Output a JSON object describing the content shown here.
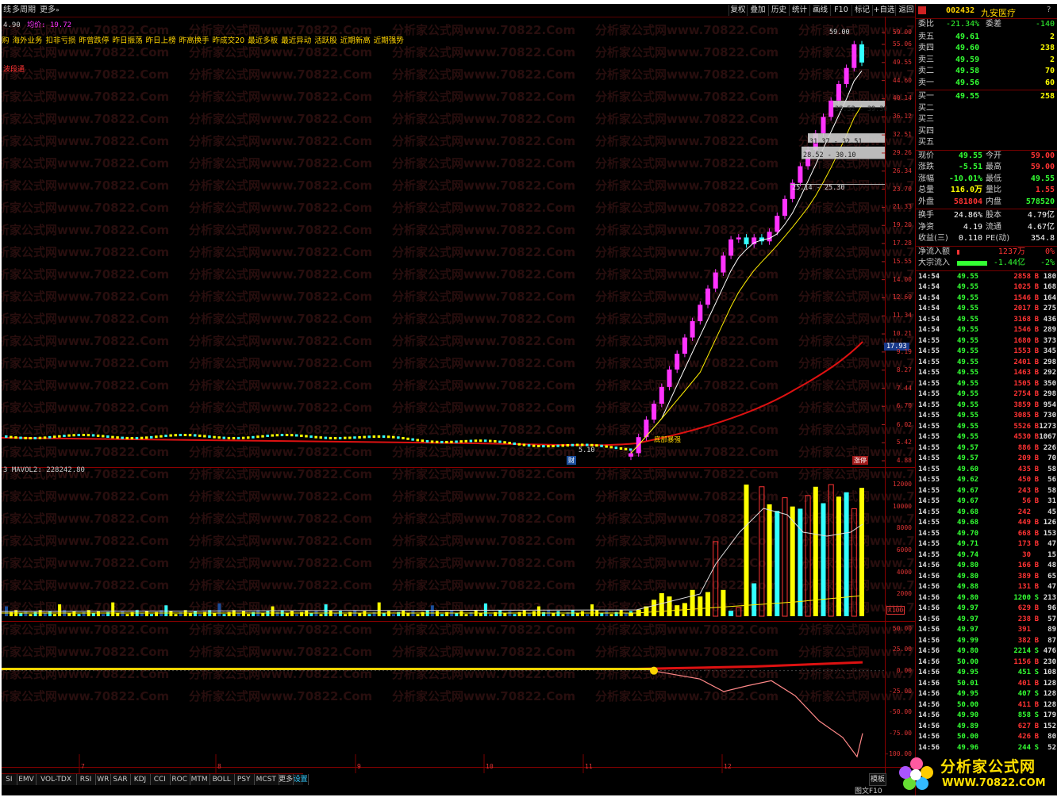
{
  "toolbar": {
    "left_items": [
      "线",
      "多周期",
      "更多"
    ],
    "right_buttons": [
      "复权",
      "叠加",
      "历史",
      "统计",
      "F10",
      "标记",
      "+自选",
      "返回"
    ],
    "overlay_btn": "画线"
  },
  "chart_header": {
    "value1": "4.90",
    "label2": "均价",
    "value2": "19.72"
  },
  "indicators": [
    "购",
    "海外业务",
    "扣非亏损",
    "昨曾跌停",
    "昨日振荡",
    "昨日上榜",
    "昨高换手",
    "昨成交20",
    "最近多板",
    "最近异动",
    "活跃股",
    "近期新高",
    "近期强势"
  ],
  "side_label": "波段通",
  "price_axis": [
    "59.00",
    "55.06",
    "49.55",
    "44.60",
    "40.14",
    "36.12",
    "32.51",
    "29.26",
    "26.34",
    "23.70",
    "21.33",
    "19.20",
    "17.28",
    "15.55",
    "14.00",
    "12.60",
    "11.34",
    "10.21",
    "9.19",
    "8.27",
    "7.44",
    "6.70",
    "6.02",
    "5.42",
    "4.88"
  ],
  "price_marks": {
    "top": "59.00",
    "current": "17.93",
    "low": "5.10",
    "annot": "底部暴强"
  },
  "gaps": [
    "38.52 - 39.30",
    "31.37 - 32.51",
    "28.52 - 30.10",
    "25.14 - 25.30"
  ],
  "badges": {
    "fin": "财",
    "limit": "涨停"
  },
  "volume_pane": {
    "label": "MAVOL2: 228242.80",
    "axis": [
      "12000",
      "10000",
      "8000",
      "6000",
      "4000",
      "2000"
    ],
    "unit": "X100"
  },
  "osc_axis": [
    "50.00",
    "25.00",
    "0.00",
    "-25.00",
    "-50.00",
    "-75.00",
    "-100.00"
  ],
  "month_marks": [
    "7",
    "8",
    "9",
    "10",
    "11",
    "12"
  ],
  "bottom_tabs": [
    "SI",
    "EMV",
    "VOL-TDX",
    "RSI",
    "WR",
    "SAR",
    "KDJ",
    "CCI",
    "ROC",
    "MTM",
    "BOLL",
    "PSY",
    "MCST",
    "更多",
    "设置"
  ],
  "bottom_right": [
    "模板",
    "图文F10"
  ],
  "stock": {
    "code": "002432",
    "name": "九安医疗"
  },
  "quote_top": [
    {
      "label": "委比",
      "v1": "-21.34%",
      "label2": "委差",
      "v2": "-140"
    }
  ],
  "order_book": {
    "asks": [
      {
        "label": "卖五",
        "price": "49.61",
        "vol": "2"
      },
      {
        "label": "卖四",
        "price": "49.60",
        "vol": "238"
      },
      {
        "label": "卖三",
        "price": "49.59",
        "vol": "2"
      },
      {
        "label": "卖二",
        "price": "49.58",
        "vol": "70"
      },
      {
        "label": "卖一",
        "price": "49.56",
        "vol": "60"
      }
    ],
    "bids": [
      {
        "label": "买一",
        "price": "49.55",
        "vol": "258"
      },
      {
        "label": "买二",
        "price": "",
        "vol": ""
      },
      {
        "label": "买三",
        "price": "",
        "vol": ""
      },
      {
        "label": "买四",
        "price": "",
        "vol": ""
      },
      {
        "label": "买五",
        "price": "",
        "vol": ""
      }
    ]
  },
  "quote_stats": [
    {
      "l1": "现价",
      "v1": "49.55",
      "c1": "#33ff33",
      "l2": "今开",
      "v2": "59.00",
      "c2": "#ff3333"
    },
    {
      "l1": "涨跌",
      "v1": "-5.51",
      "c1": "#33ff33",
      "l2": "最高",
      "v2": "59.00",
      "c2": "#ff3333"
    },
    {
      "l1": "涨幅",
      "v1": "-10.01%",
      "c1": "#33ff33",
      "l2": "最低",
      "v2": "49.55",
      "c2": "#33ff33"
    },
    {
      "l1": "总量",
      "v1": "116.0万",
      "c1": "#ffff00",
      "l2": "量比",
      "v2": "1.55",
      "c2": "#ff3333"
    },
    {
      "l1": "外盘",
      "v1": "581804",
      "c1": "#ff3333",
      "l2": "内盘",
      "v2": "578520",
      "c2": "#33ff33"
    }
  ],
  "fundamentals": [
    {
      "l1": "换手",
      "v1": "24.86%",
      "l2": "股本",
      "v2": "4.79亿"
    },
    {
      "l1": "净资",
      "v1": "4.19",
      "l2": "流通",
      "v2": "4.67亿"
    },
    {
      "l1": "收益(三)",
      "v1": "0.110",
      "l2": "PE(动)",
      "v2": "354.8"
    }
  ],
  "flows": [
    {
      "label": "净流入额",
      "amount": "1237万",
      "pct": "0%"
    },
    {
      "label": "大宗流入",
      "amount": "-1.44亿",
      "pct": "-2%"
    }
  ],
  "ticks": [
    [
      "14:54",
      "49.55",
      "2858",
      "B",
      "180"
    ],
    [
      "14:54",
      "49.55",
      "1025",
      "B",
      "168"
    ],
    [
      "14:54",
      "49.55",
      "1546",
      "B",
      "164"
    ],
    [
      "14:54",
      "49.55",
      "2017",
      "B",
      "275"
    ],
    [
      "14:54",
      "49.55",
      "3168",
      "B",
      "436"
    ],
    [
      "14:54",
      "49.55",
      "1546",
      "B",
      "289"
    ],
    [
      "14:55",
      "49.55",
      "1680",
      "B",
      "373"
    ],
    [
      "14:55",
      "49.55",
      "1553",
      "B",
      "345"
    ],
    [
      "14:55",
      "49.55",
      "2401",
      "B",
      "298"
    ],
    [
      "14:55",
      "49.55",
      "1463",
      "B",
      "292"
    ],
    [
      "14:55",
      "49.55",
      "1505",
      "B",
      "350"
    ],
    [
      "14:55",
      "49.55",
      "2754",
      "B",
      "298"
    ],
    [
      "14:55",
      "49.55",
      "3859",
      "B",
      "954"
    ],
    [
      "14:55",
      "49.55",
      "3085",
      "B",
      "730"
    ],
    [
      "14:55",
      "49.55",
      "5526",
      "B",
      "1273"
    ],
    [
      "14:55",
      "49.55",
      "4530",
      "B",
      "1067"
    ],
    [
      "14:55",
      "49.57",
      "886",
      "B",
      "226"
    ],
    [
      "14:55",
      "49.57",
      "209",
      "B",
      "70"
    ],
    [
      "14:55",
      "49.60",
      "435",
      "B",
      "58"
    ],
    [
      "14:55",
      "49.62",
      "450",
      "B",
      "56"
    ],
    [
      "14:55",
      "49.67",
      "243",
      "B",
      "58"
    ],
    [
      "14:55",
      "49.67",
      "56",
      "B",
      "31"
    ],
    [
      "14:55",
      "49.68",
      "242",
      "",
      "45"
    ],
    [
      "14:55",
      "49.68",
      "449",
      "B",
      "126"
    ],
    [
      "14:55",
      "49.70",
      "668",
      "B",
      "153"
    ],
    [
      "14:55",
      "49.71",
      "173",
      "B",
      "47"
    ],
    [
      "14:55",
      "49.74",
      "30",
      "",
      "15"
    ],
    [
      "14:56",
      "49.80",
      "166",
      "B",
      "48"
    ],
    [
      "14:56",
      "49.80",
      "389",
      "B",
      "65"
    ],
    [
      "14:56",
      "49.88",
      "131",
      "B",
      "47"
    ],
    [
      "14:56",
      "49.80",
      "1200",
      "S",
      "213"
    ],
    [
      "14:56",
      "49.97",
      "629",
      "B",
      "96"
    ],
    [
      "14:56",
      "49.97",
      "238",
      "B",
      "57"
    ],
    [
      "14:56",
      "49.97",
      "391",
      "",
      "89"
    ],
    [
      "14:56",
      "49.99",
      "382",
      "B",
      "87"
    ],
    [
      "14:56",
      "49.80",
      "2214",
      "S",
      "476"
    ],
    [
      "14:56",
      "50.00",
      "1156",
      "B",
      "230"
    ],
    [
      "14:56",
      "49.95",
      "451",
      "S",
      "108"
    ],
    [
      "14:56",
      "50.01",
      "401",
      "B",
      "128"
    ],
    [
      "14:56",
      "49.95",
      "407",
      "S",
      "128"
    ],
    [
      "14:56",
      "50.00",
      "411",
      "B",
      "128"
    ],
    [
      "14:56",
      "49.90",
      "858",
      "S",
      "179"
    ],
    [
      "14:56",
      "49.89",
      "627",
      "B",
      "152"
    ],
    [
      "14:56",
      "50.00",
      "426",
      "B",
      "80"
    ],
    [
      "14:56",
      "49.96",
      "244",
      "S",
      "52"
    ]
  ],
  "watermark": "分析家公式网www.70822.Com",
  "logo": {
    "title": "分析家公式网",
    "url": "WWW.70822.COM"
  },
  "colors": {
    "up": "#ff33ff",
    "down": "#33ffff",
    "red": "#ff3333",
    "green": "#33ff33",
    "yellow": "#ffff00",
    "bg": "#000000"
  },
  "chart_data": [
    {
      "type": "candlestick",
      "title": "",
      "y_range": [
        4.88,
        59.0
      ],
      "scale": "log",
      "recent_closes": [
        5.1,
        5.6,
        6.2,
        6.8,
        7.5,
        8.3,
        9.1,
        10.0,
        11.0,
        12.1,
        13.3,
        14.6,
        16.1,
        17.7,
        17.9,
        17.2,
        17.9,
        17.5,
        18.5,
        20.3,
        22.4,
        24.6,
        27.1,
        29.8,
        32.8,
        36.1,
        39.7,
        43.7,
        48.0,
        55.1,
        49.55
      ]
    },
    {
      "type": "bar",
      "title": "MAVOL2: 228242.80",
      "y_range": [
        0,
        12000
      ]
    },
    {
      "type": "line",
      "y_range": [
        -100,
        50
      ]
    }
  ]
}
